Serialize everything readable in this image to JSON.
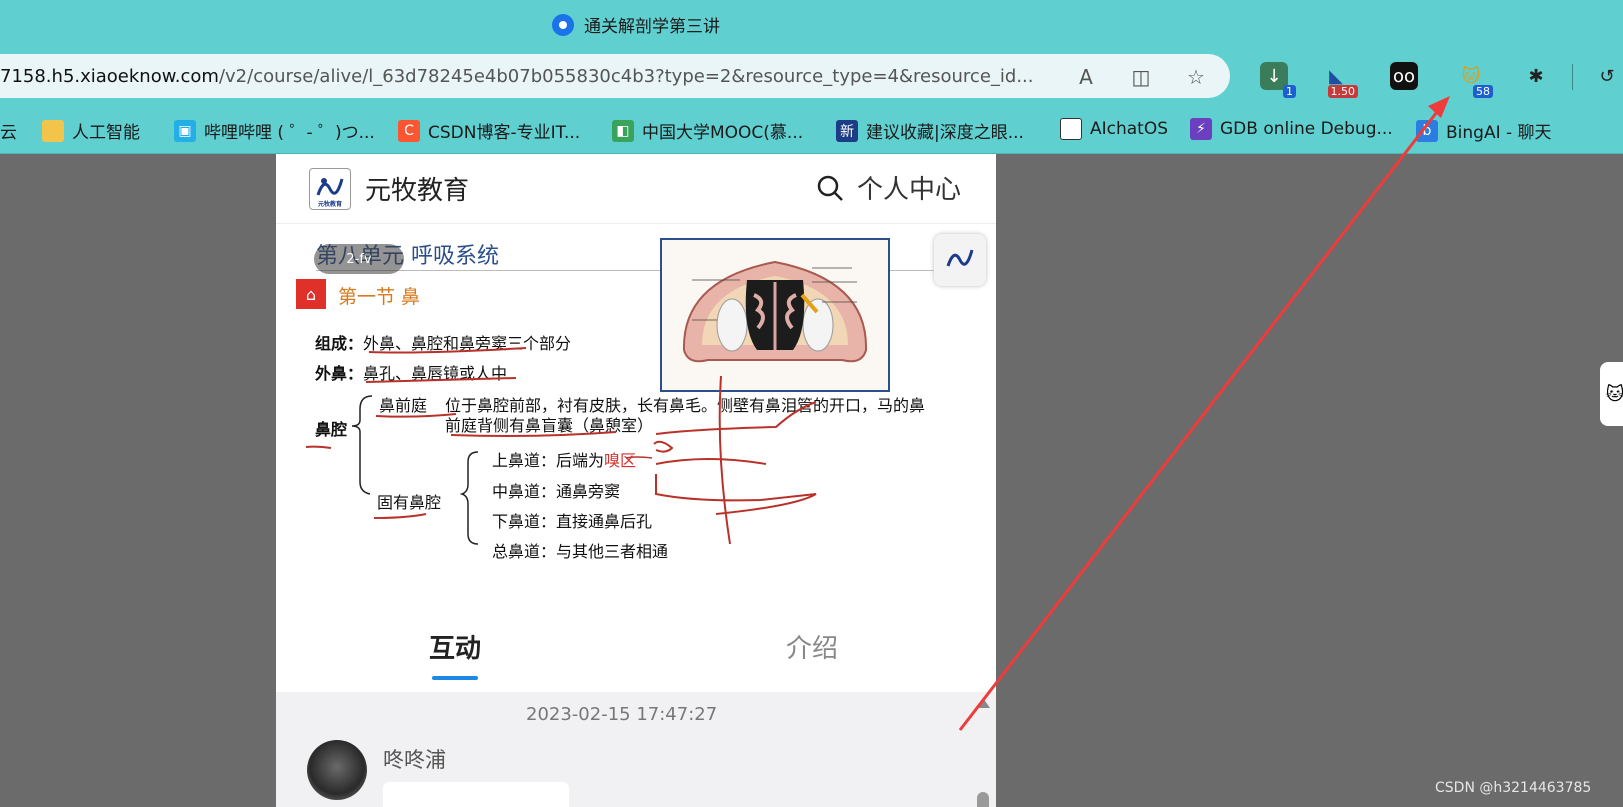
{
  "window": {
    "title": "通关解剖学第三讲"
  },
  "address": {
    "host": "7158.h5.xiaoeknow.com",
    "path": "/v2/course/alive/l_63d78245e4b07b055830c4b3?type=2&resource_type=4&resource_id..."
  },
  "extensions": [
    {
      "icon": "download-icon",
      "badge": "1"
    },
    {
      "icon": "speed-icon",
      "badge": "1.50"
    },
    {
      "icon": "glasses-icon",
      "badge": ""
    },
    {
      "icon": "cat-icon",
      "badge": "58"
    }
  ],
  "bookmarks": [
    {
      "label": "云",
      "icon": "cloud-icon",
      "color": "#5fcfd0"
    },
    {
      "label": "人工智能",
      "icon": "folder-icon",
      "color": "#f2c44a"
    },
    {
      "label": "哔哩哔哩 ( ゜- ゜)つ...",
      "icon": "bilibili-icon",
      "color": "#23aee5"
    },
    {
      "label": "CSDN博客-专业IT...",
      "icon": "csdn-icon",
      "color": "#fc5531"
    },
    {
      "label": "中国大学MOOC(慕...",
      "icon": "mooc-icon",
      "color": "#3aa35b"
    },
    {
      "label": "建议收藏|深度之眼...",
      "icon": "news-icon",
      "color": "#1d3c86"
    },
    {
      "label": "AIchatOS",
      "icon": "file-icon",
      "color": "#ffffff"
    },
    {
      "label": "GDB online Debug...",
      "icon": "bolt-icon",
      "color": "#6c3fc0"
    },
    {
      "label": "BingAI - 聊天",
      "icon": "bing-icon",
      "color": "#2a7de1"
    }
  ],
  "site": {
    "brand": "元牧教育",
    "personal_center": "个人中心",
    "logo_text": "元牧教育"
  },
  "slide": {
    "title": "第八单元 呼吸系统",
    "progress_tag": "2-fv",
    "section": "第一节 鼻",
    "composition_label": "组成：",
    "composition_text": "外鼻、鼻腔和鼻旁窦三个部分",
    "external_label": "外鼻：",
    "external_text": "鼻孔、鼻唇镜或人中",
    "cavity_label": "鼻腔",
    "vestibule_label": "鼻前庭",
    "vestibule_text_1": "位于鼻腔前部，衬有皮肤，长有鼻毛。侧壁有鼻泪管的开口，马的鼻",
    "vestibule_text_2": "前庭背侧有鼻盲囊（鼻憩室）",
    "proper_label": "固有鼻腔",
    "meatus_sup_label": "上鼻道：后端为",
    "meatus_sup_highlight": "嗅区",
    "meatus_mid": "中鼻道：通鼻旁窦",
    "meatus_inf": "下鼻道：直接通鼻后孔",
    "meatus_com": "总鼻道：与其他三者相通"
  },
  "tabs": {
    "interaction": "互动",
    "intro": "介绍"
  },
  "chat": {
    "timestamp": "2023-02-15 17:47:27",
    "username": "咚咚浦"
  },
  "watermark": "CSDN @h3214463785"
}
